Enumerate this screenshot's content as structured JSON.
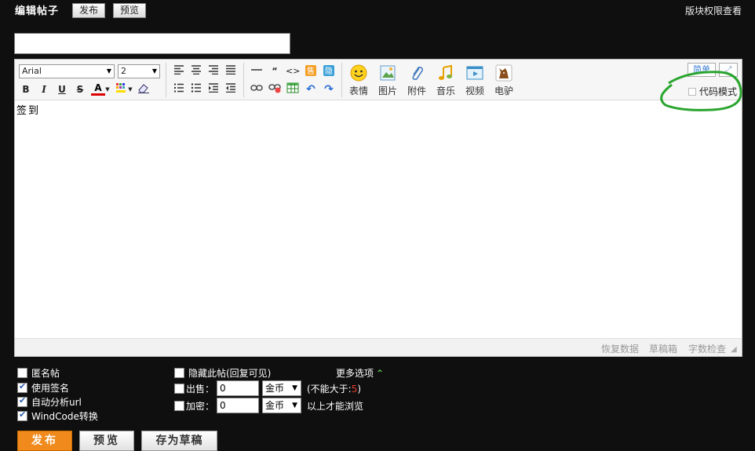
{
  "header": {
    "title": "编辑帖子",
    "tabs": [
      "发布",
      "预览"
    ],
    "permission_link": "版块权限查看"
  },
  "title_input": {
    "value": ""
  },
  "editor": {
    "font_family": "Arial",
    "font_size": "2",
    "insert_buttons": [
      "表情",
      "图片",
      "附件",
      "音乐",
      "视频",
      "电驴"
    ],
    "mode_buttons": [
      "简单"
    ],
    "code_mode_label": "代码模式",
    "content": "签到"
  },
  "statusbar": {
    "links": [
      "恢复数据",
      "草稿箱",
      "字数检查"
    ]
  },
  "options": {
    "anonymous": {
      "label": "匿名帖",
      "checked": false
    },
    "use_signature": {
      "label": "使用签名",
      "checked": true
    },
    "auto_url": {
      "label": "自动分析url",
      "checked": true
    },
    "windcode": {
      "label": "WindCode转换",
      "checked": true
    },
    "hide_post": {
      "label": "隐藏此帖(回复可见)",
      "checked": false
    },
    "more_options": "更多选项",
    "sell": {
      "label": "出售：",
      "value": "0",
      "currency": "金币",
      "note_prefix": "(不能大于:",
      "note_value": "5",
      "note_suffix": ")"
    },
    "encrypt": {
      "label": "加密：",
      "value": "0",
      "currency": "金币",
      "note": "以上才能浏览"
    }
  },
  "buttons": {
    "publish": "发布",
    "preview": "预览",
    "save_draft": "存为草稿"
  },
  "colors": {
    "background": "#0f0f0f",
    "publish_button": "#f08a1c",
    "annotation_circle": "#2aa52f",
    "note_value": "#e53b2c"
  }
}
